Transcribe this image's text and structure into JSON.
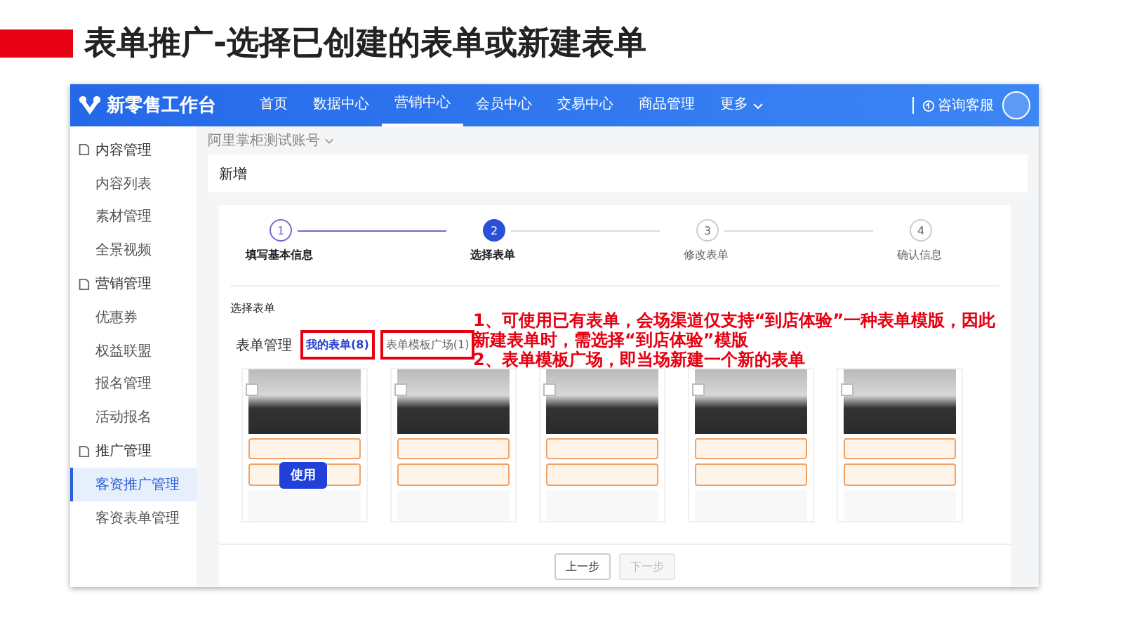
{
  "slide_title": "表单推广-选择已创建的表单或新建表单",
  "app": {
    "logo": "新零售工作台",
    "nav": [
      {
        "label": "首页",
        "selected": false
      },
      {
        "label": "数据中心",
        "selected": false
      },
      {
        "label": "营销中心",
        "selected": true
      },
      {
        "label": "会员中心",
        "selected": false
      },
      {
        "label": "交易中心",
        "selected": false
      },
      {
        "label": "商品管理",
        "selected": false
      },
      {
        "label": "更多",
        "selected": false
      }
    ],
    "support": "咨询客服"
  },
  "sidebar": [
    {
      "label": "内容管理",
      "children": [
        {
          "label": "内容列表",
          "selected": false
        },
        {
          "label": "素材管理",
          "selected": false
        },
        {
          "label": "全景视频",
          "selected": false
        }
      ]
    },
    {
      "label": "营销管理",
      "children": [
        {
          "label": "优惠券",
          "selected": false
        },
        {
          "label": "权益联盟",
          "selected": false
        },
        {
          "label": "报名管理",
          "selected": false
        },
        {
          "label": "活动报名",
          "selected": false
        }
      ]
    },
    {
      "label": "推广管理",
      "children": [
        {
          "label": "客资推广管理",
          "selected": true
        },
        {
          "label": "客资表单管理",
          "selected": false
        }
      ]
    }
  ],
  "account": "阿里掌柜测试账号",
  "page_title": "新增",
  "steps": [
    {
      "number": "1",
      "label": "填写基本信息",
      "completed": true,
      "selected": false
    },
    {
      "number": "2",
      "label": "选择表单",
      "completed": false,
      "selected": true
    },
    {
      "number": "3",
      "label": "修改表单",
      "completed": false,
      "selected": false
    },
    {
      "number": "4",
      "label": "确认信息",
      "completed": false,
      "selected": false
    }
  ],
  "section_title": "选择表单",
  "form_manage_label": "表单管理",
  "form_tabs": [
    {
      "label": "我的表单(8)",
      "selected": true
    },
    {
      "label": "表单模板广场(1)",
      "selected": false
    }
  ],
  "templates": [
    {
      "checked": false,
      "use_button": "使用"
    },
    {
      "checked": false
    },
    {
      "checked": false
    },
    {
      "checked": false
    },
    {
      "checked": false
    }
  ],
  "buttons": [
    {
      "label": "上一步",
      "disabled": false
    },
    {
      "label": "下一步",
      "disabled": true
    }
  ],
  "annotation": [
    "1、可使用已有表单，会场渠道仅支持“到店体验”一种表单模版，因此新建表单时，需选择“到店体验”模版",
    "2、表单模板广场，即当场新建一个新的表单"
  ]
}
